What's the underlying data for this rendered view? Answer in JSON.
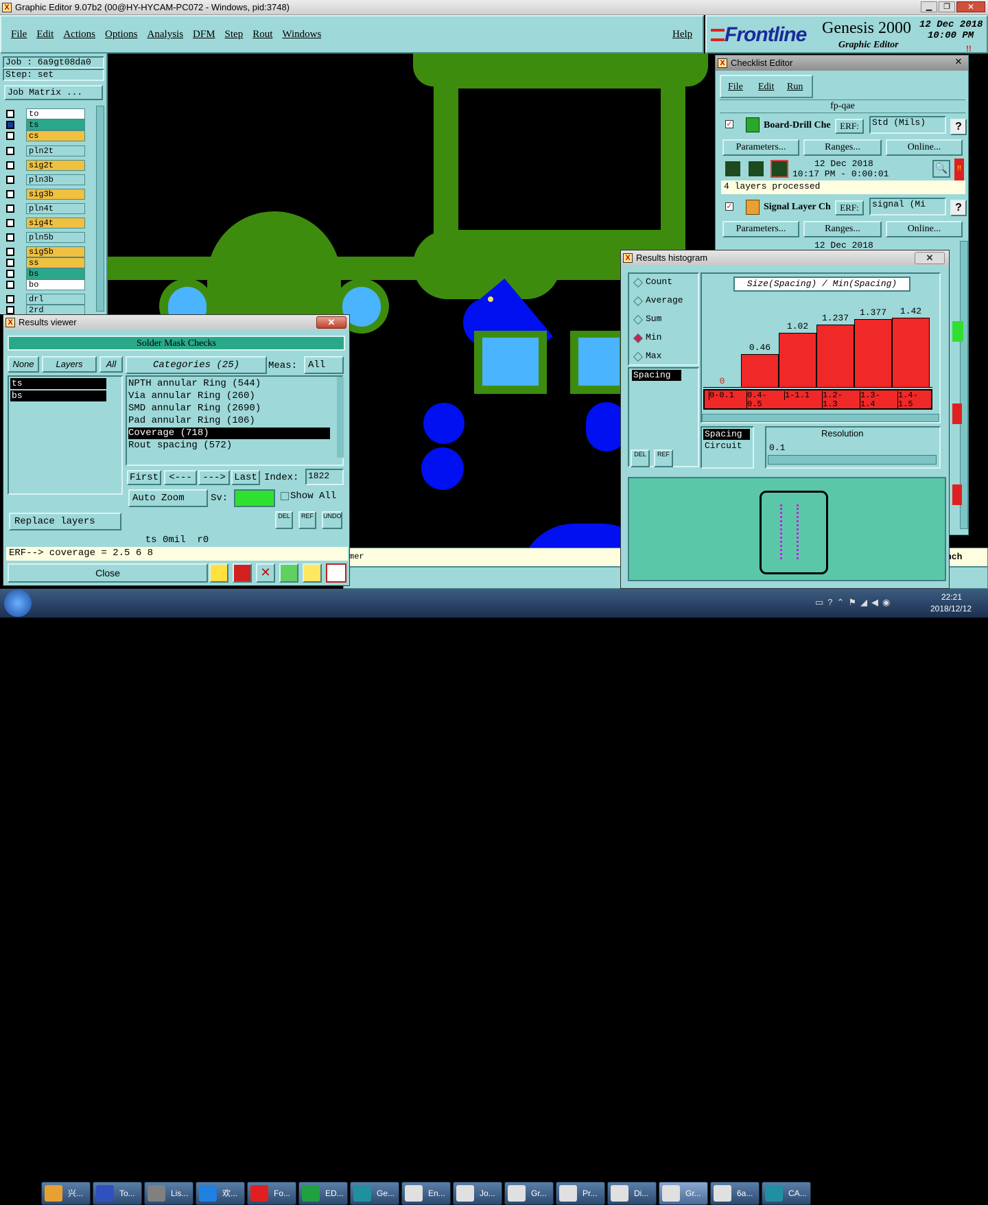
{
  "window": {
    "title": "Graphic Editor 9.07b2 (00@HY-HYCAM-PC072 - Windows, pid:3748)"
  },
  "menubar": {
    "items": [
      "File",
      "Edit",
      "Actions",
      "Options",
      "Analysis",
      "DFM",
      "Step",
      "Rout",
      "Windows"
    ],
    "help": "Help"
  },
  "brand": {
    "logo": "Frontline",
    "product": "Genesis 2000",
    "subtitle": "Graphic Editor",
    "date": "12 Dec 2018",
    "time": "10:00 PM"
  },
  "job": {
    "job_label": "Job : 6a9gt08da0",
    "step_label": "Step: set",
    "matrix_button": "Job Matrix ..."
  },
  "layers": [
    {
      "name": "to",
      "color": "#ffffff"
    },
    {
      "name": "ts",
      "color": "#2aa88a"
    },
    {
      "name": "cs",
      "color": "#f0c040"
    },
    {
      "name": "pln2t",
      "color": "#9ed8d8"
    },
    {
      "name": "sig2t",
      "color": "#f0c040"
    },
    {
      "name": "pln3b",
      "color": "#9ed8d8"
    },
    {
      "name": "sig3b",
      "color": "#f0c040"
    },
    {
      "name": "pln4t",
      "color": "#9ed8d8"
    },
    {
      "name": "sig4t",
      "color": "#f0c040"
    },
    {
      "name": "pln5b",
      "color": "#9ed8d8"
    },
    {
      "name": "sig5b",
      "color": "#f0c040"
    },
    {
      "name": "ss",
      "color": "#f0c040"
    },
    {
      "name": "bs",
      "color": "#2aa88a"
    },
    {
      "name": "bo",
      "color": "#ffffff"
    },
    {
      "name": "drl",
      "color": "#9ed8d8"
    },
    {
      "name": "2rd",
      "color": "#9ed8d8"
    }
  ],
  "checklist": {
    "title": "Checklist Editor",
    "menu": [
      "File",
      "Edit",
      "Run"
    ],
    "name": "fp-qae",
    "actions": [
      {
        "name": "Board-Drill Che",
        "erf_label": "ERF:",
        "erf_value": "Std (Mils)",
        "help": "?",
        "buttons": [
          "Parameters...",
          "Ranges...",
          "Online..."
        ],
        "date": "12 Dec 2018",
        "time_line": "10:17 PM - 0:00:01",
        "status": "4 layers processed"
      },
      {
        "name": "Signal Layer Ch",
        "erf_label": "ERF:",
        "erf_value": "signal (Mi",
        "help": "?",
        "buttons": [
          "Parameters...",
          "Ranges...",
          "Online..."
        ],
        "date": "12 Dec 2018"
      }
    ]
  },
  "results_viewer": {
    "title": "Results viewer",
    "header": "Solder Mask Checks",
    "filter_buttons": [
      "None",
      "Layers",
      "All"
    ],
    "categories_label": "Categories (25)",
    "meas_label": "Meas:",
    "meas_value": "All",
    "layers": [
      "ts",
      "bs"
    ],
    "categories": [
      "NPTH annular Ring (544)",
      "Via annular Ring (260)",
      "SMD annular Ring (2690)",
      "Pad annular Ring (106)",
      "Coverage (718)",
      "Rout spacing (572)"
    ],
    "selected_category": "Coverage (718)",
    "nav": {
      "first": "First",
      "prev": "<---",
      "next": "--->",
      "last": "Last",
      "index_label": "Index:",
      "index_value": "1822"
    },
    "auto_zoom": "Auto Zoom",
    "sv_label": "Sv:",
    "show_all": "Show All",
    "replace_layers": "Replace layers",
    "tool_labels": [
      "DEL",
      "REF",
      "UNDO"
    ],
    "info_line": "ts 0mil  r0",
    "erf_line": "ERF--> coverage = 2.5 6 8",
    "close": "Close"
  },
  "results_histogram": {
    "title": "Results histogram",
    "modes": [
      "Count",
      "Average",
      "Sum",
      "Min",
      "Max"
    ],
    "selected_mode": "Min",
    "measure_list": [
      "Spacing"
    ],
    "chart_title": "Size(Spacing) / Min(Spacing)",
    "lower_list": [
      "Spacing",
      "Circuit"
    ],
    "resolution_label": "Resolution",
    "resolution_value": "0.1",
    "tool_labels": [
      "DEL",
      "REF"
    ]
  },
  "chart_data": {
    "type": "bar",
    "title": "Size(Spacing) / Min(Spacing)",
    "categories": [
      "0-0.1",
      "0.4-0.5",
      "1-1.1",
      "1.2-1.3",
      "1.3-1.4",
      "1.4-1.5"
    ],
    "values": [
      0,
      0.46,
      1.02,
      1.237,
      1.377,
      1.42
    ],
    "bar_color": "#f02828"
  },
  "status_strip": {
    "left_text": "mer",
    "right_text": "nch"
  },
  "taskbar": {
    "buttons": [
      "兴...",
      "To...",
      "Lis...",
      "欢...",
      "Fo...",
      "ED...",
      "Ge...",
      "En...",
      "Jo...",
      "Gr...",
      "Pr...",
      "Di...",
      "Gr...",
      "6a...",
      "CA..."
    ],
    "clock_time": "22:21",
    "clock_date": "2018/12/12"
  }
}
